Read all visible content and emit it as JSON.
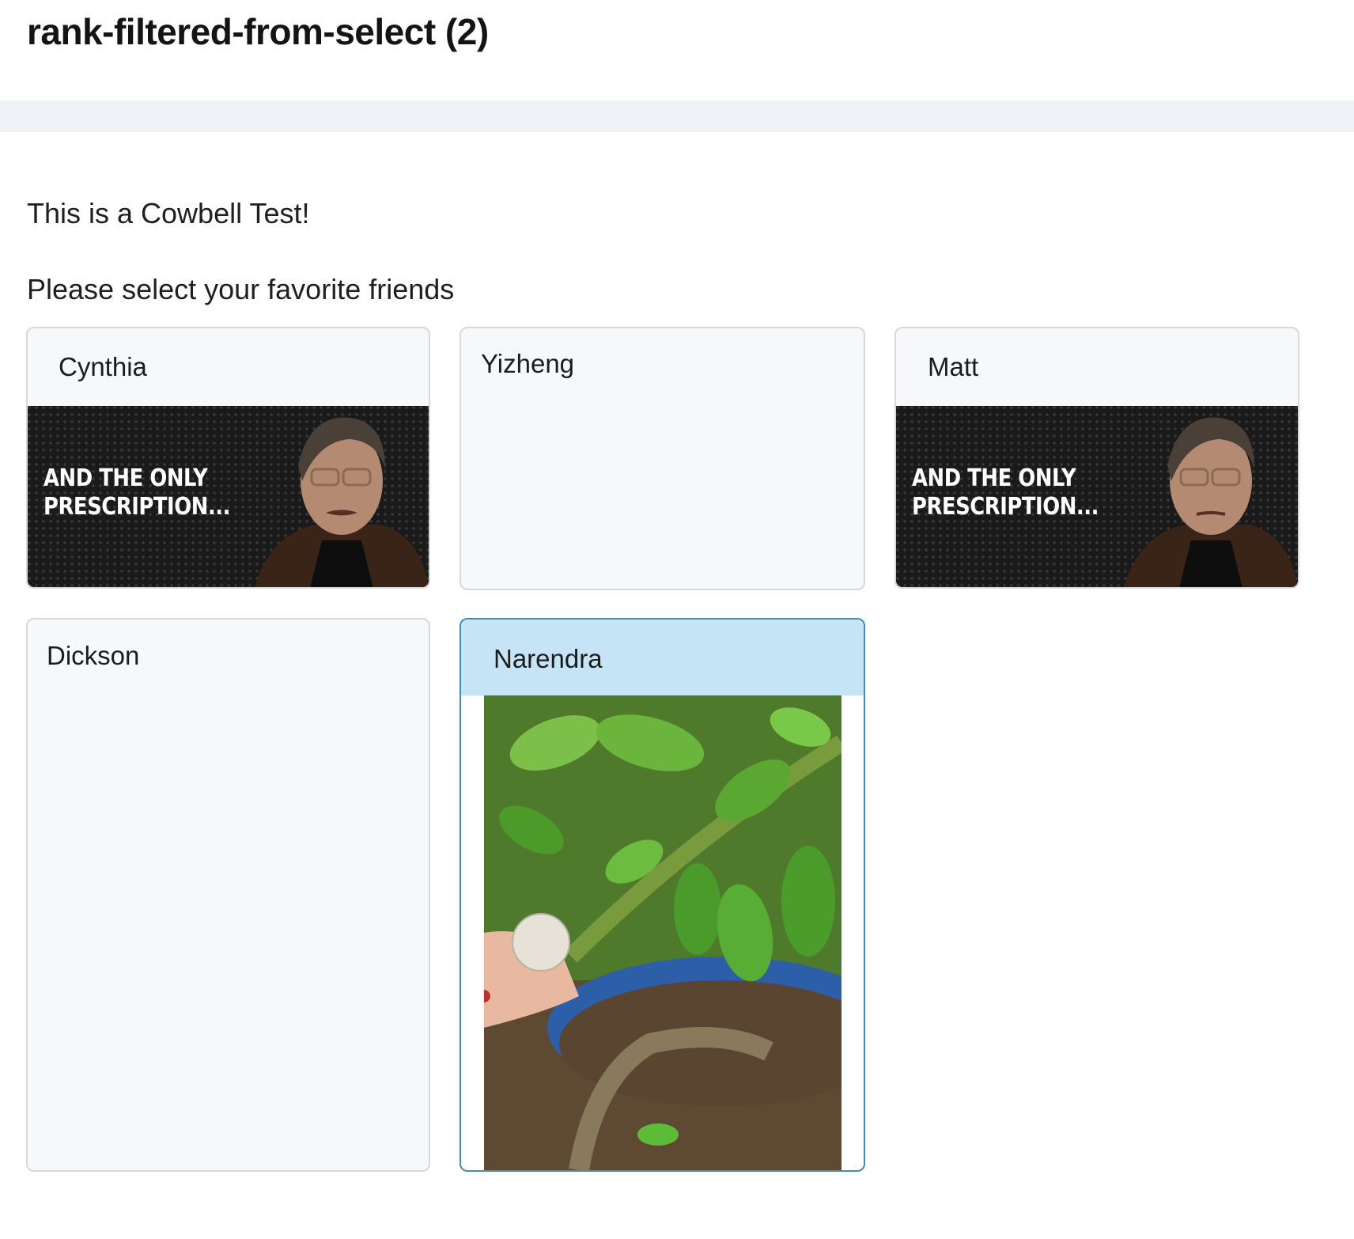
{
  "page": {
    "title": "rank-filtered-from-select (2)",
    "intro": "This is a Cowbell Test!",
    "prompt": "Please select your favorite friends"
  },
  "colors": {
    "selected_header": "#c5e4f5",
    "selected_border": "#3a8fbd",
    "card_bg": "#f7f8fa",
    "band": "#eff3f7"
  },
  "cards": [
    {
      "name": "Cynthia",
      "image": "cowbell-meme",
      "caption_line1": "AND THE ONLY",
      "caption_line2": "PRESCRIPTION...",
      "selected": false
    },
    {
      "name": "Yizheng",
      "image": null,
      "selected": false
    },
    {
      "name": "Matt",
      "image": "cowbell-meme",
      "caption_line1": "AND THE ONLY",
      "caption_line2": "PRESCRIPTION...",
      "selected": false
    },
    {
      "name": "Dickson",
      "image": null,
      "selected": false
    },
    {
      "name": "Narendra",
      "image": "plant-photo",
      "selected": true
    }
  ]
}
